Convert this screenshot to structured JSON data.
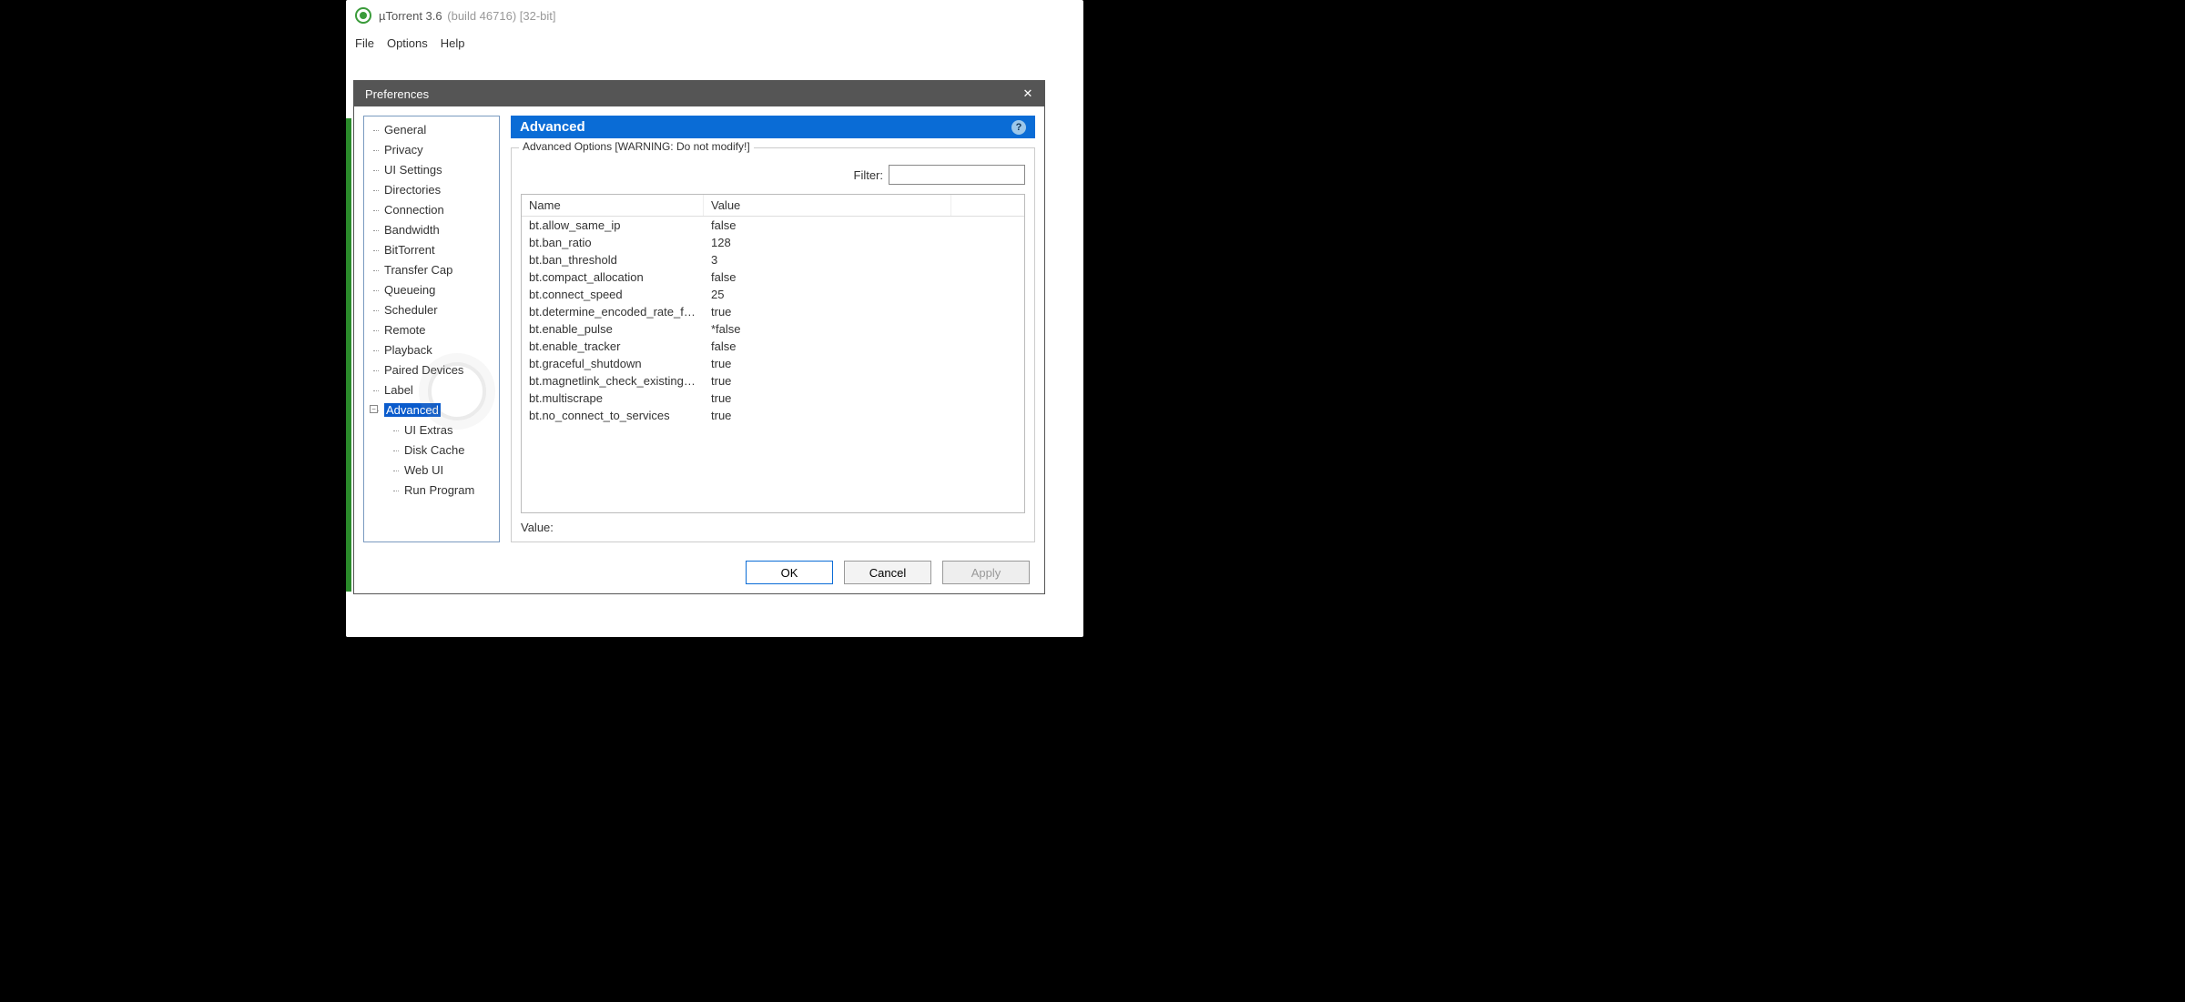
{
  "app": {
    "title": "µTorrent 3.6",
    "build": "(build 46716) [32-bit]"
  },
  "menu": {
    "file": "File",
    "options": "Options",
    "help": "Help"
  },
  "prefs": {
    "title": "Preferences",
    "section_header": "Advanced",
    "group_label": "Advanced Options [WARNING: Do not modify!]",
    "filter_label": "Filter:",
    "filter_value": "",
    "value_label": "Value:",
    "tree_expander": "−",
    "tree": [
      {
        "label": "General"
      },
      {
        "label": "Privacy"
      },
      {
        "label": "UI Settings"
      },
      {
        "label": "Directories"
      },
      {
        "label": "Connection"
      },
      {
        "label": "Bandwidth"
      },
      {
        "label": "BitTorrent"
      },
      {
        "label": "Transfer Cap"
      },
      {
        "label": "Queueing"
      },
      {
        "label": "Scheduler"
      },
      {
        "label": "Remote"
      },
      {
        "label": "Playback"
      },
      {
        "label": "Paired Devices"
      },
      {
        "label": "Label"
      },
      {
        "label": "Advanced",
        "selected": true
      },
      {
        "label": "UI Extras",
        "child": true
      },
      {
        "label": "Disk Cache",
        "child": true
      },
      {
        "label": "Web UI",
        "child": true
      },
      {
        "label": "Run Program",
        "child": true
      }
    ],
    "columns": {
      "name": "Name",
      "value": "Value"
    },
    "rows": [
      {
        "name": "bt.allow_same_ip",
        "value": "false"
      },
      {
        "name": "bt.ban_ratio",
        "value": "128"
      },
      {
        "name": "bt.ban_threshold",
        "value": "3"
      },
      {
        "name": "bt.compact_allocation",
        "value": "false"
      },
      {
        "name": "bt.connect_speed",
        "value": "25"
      },
      {
        "name": "bt.determine_encoded_rate_fo...",
        "value": "true"
      },
      {
        "name": "bt.enable_pulse",
        "value": "*false"
      },
      {
        "name": "bt.enable_tracker",
        "value": "false"
      },
      {
        "name": "bt.graceful_shutdown",
        "value": "true"
      },
      {
        "name": "bt.magnetlink_check_existing_...",
        "value": "true"
      },
      {
        "name": "bt.multiscrape",
        "value": "true"
      },
      {
        "name": "bt.no_connect_to_services",
        "value": "true"
      }
    ],
    "buttons": {
      "ok": "OK",
      "cancel": "Cancel",
      "apply": "Apply"
    }
  }
}
